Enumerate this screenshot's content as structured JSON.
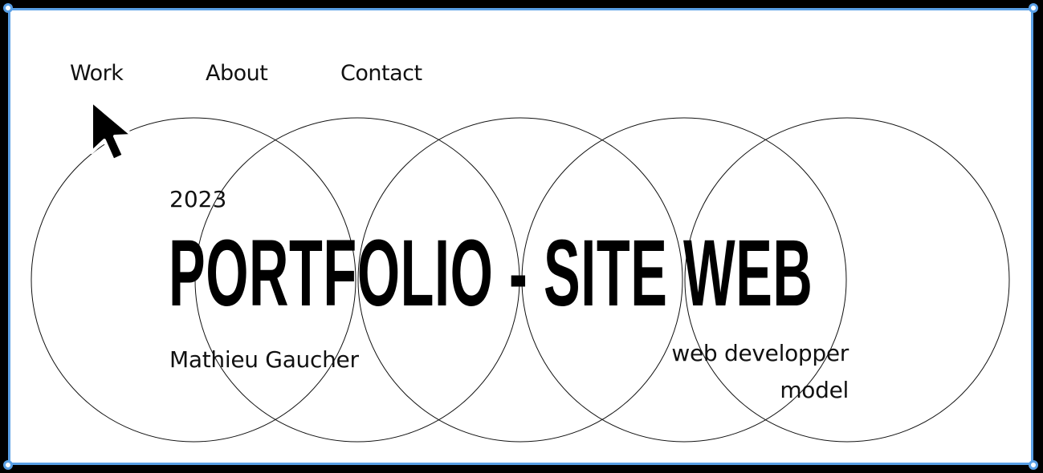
{
  "nav": {
    "items": [
      {
        "label": "Work"
      },
      {
        "label": "About"
      },
      {
        "label": "Contact"
      }
    ]
  },
  "hero": {
    "year": "2023",
    "title": "PORTFOLIO - SITE WEB",
    "author": "Mathieu Gaucher",
    "roles": [
      "web developper",
      "model"
    ]
  },
  "colors": {
    "background": "#ffffff",
    "text": "#000000",
    "selection": "#5aa0e6",
    "outer": "#000000"
  },
  "icons": {
    "cursor": "mouse-pointer-arrow-icon"
  }
}
